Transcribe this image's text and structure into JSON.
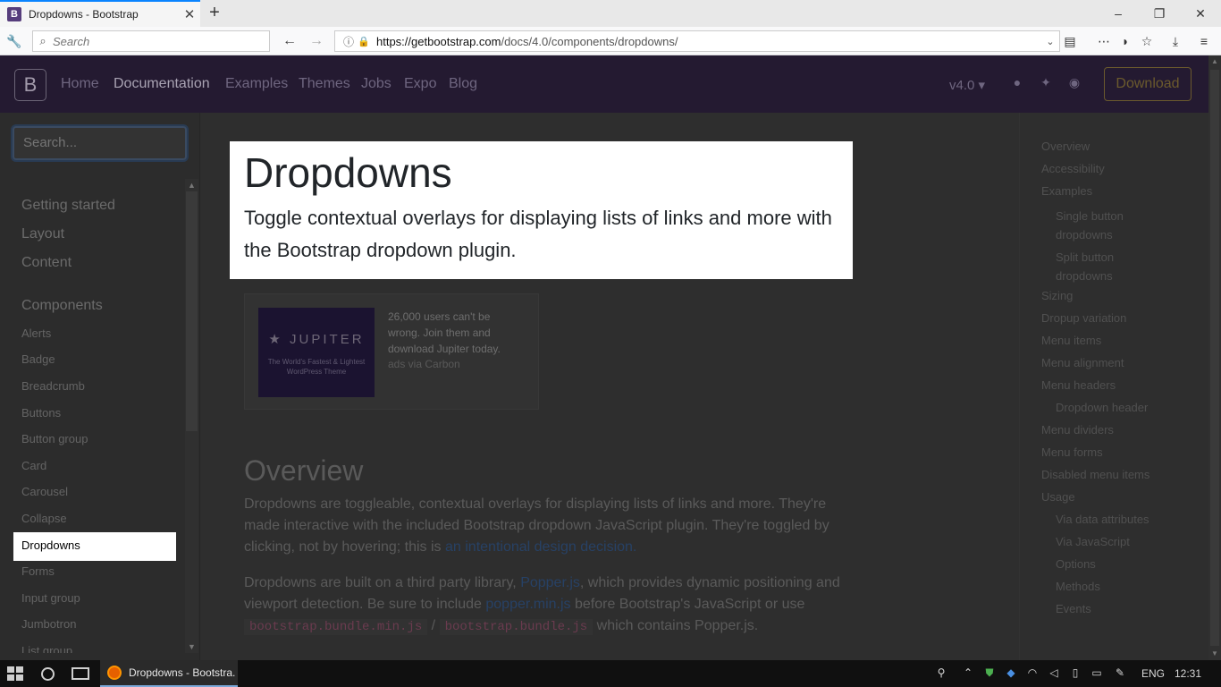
{
  "browser": {
    "tab_title": "Dropdowns - Bootstrap",
    "tab_favicon": "B",
    "close_glyph": "✕",
    "new_tab_glyph": "+",
    "window_controls": [
      "–",
      "❐",
      "✕"
    ],
    "search_placeholder": "Search",
    "url_host": "https://getbootstrap.com",
    "url_path": "/docs/4.0/components/dropdowns/"
  },
  "site": {
    "brand": "B",
    "nav": [
      "Home",
      "Documentation",
      "Examples",
      "Themes",
      "Jobs",
      "Expo",
      "Blog"
    ],
    "active_nav": "Documentation",
    "version": "v4.0",
    "download": "Download"
  },
  "sidebar": {
    "search_placeholder": "Search...",
    "groups": [
      "Getting started",
      "Layout",
      "Content",
      "Components"
    ],
    "items": [
      "Alerts",
      "Badge",
      "Breadcrumb",
      "Buttons",
      "Button group",
      "Card",
      "Carousel",
      "Collapse",
      "Dropdowns",
      "Forms",
      "Input group",
      "Jumbotron",
      "List group"
    ],
    "active": "Dropdowns"
  },
  "main": {
    "title": "Dropdowns",
    "lead": "Toggle contextual overlays for displaying lists of links and more with the Bootstrap dropdown plugin.",
    "ad": {
      "brand": "JUPITER",
      "tagline": "The World's Fastest & Lightest WordPress Theme",
      "text": "26,000 users can't be wrong. Join them and download Jupiter today.",
      "via": "ads via Carbon"
    },
    "overview_heading": "Overview",
    "p1_a": "Dropdowns are toggleable, contextual overlays for displaying lists of links and more. They're made interactive with the included Bootstrap dropdown JavaScript plugin. They're toggled by clicking, not by hovering; this is ",
    "p1_link": "an intentional design decision.",
    "p2_a": "Dropdowns are built on a third party library, ",
    "p2_link1": "Popper.js",
    "p2_b": ", which provides dynamic positioning and viewport detection. Be sure to include ",
    "p2_link2": "popper.min.js",
    "p2_c": " before Bootstrap's JavaScript or use ",
    "p2_code1": "bootstrap.bundle.min.js",
    "p2_sep": " / ",
    "p2_code2": "bootstrap.bundle.js",
    "p2_d": " which contains Popper.js."
  },
  "toc": [
    {
      "label": "Overview",
      "level": 0
    },
    {
      "label": "Accessibility",
      "level": 0
    },
    {
      "label": "Examples",
      "level": 0
    },
    {
      "label": "Single button dropdowns",
      "level": 1
    },
    {
      "label": "Split button dropdowns",
      "level": 1
    },
    {
      "label": "Sizing",
      "level": 0
    },
    {
      "label": "Dropup variation",
      "level": 0
    },
    {
      "label": "Menu items",
      "level": 0
    },
    {
      "label": "Menu alignment",
      "level": 0
    },
    {
      "label": "Menu headers",
      "level": 0
    },
    {
      "label": "Dropdown header",
      "level": 1
    },
    {
      "label": "Menu dividers",
      "level": 0
    },
    {
      "label": "Menu forms",
      "level": 0
    },
    {
      "label": "Disabled menu items",
      "level": 0
    },
    {
      "label": "Usage",
      "level": 0
    },
    {
      "label": "Via data attributes",
      "level": 1
    },
    {
      "label": "Via JavaScript",
      "level": 1
    },
    {
      "label": "Options",
      "level": 1
    },
    {
      "label": "Methods",
      "level": 1
    },
    {
      "label": "Events",
      "level": 1
    }
  ],
  "taskbar": {
    "app_title": "Dropdowns - Bootstra...",
    "lang": "ENG",
    "time": "12:31"
  },
  "colors": {
    "brand_purple": "#563d7c",
    "link": "#007bff",
    "code": "#e83e8c",
    "highlight": "#ffffff"
  }
}
